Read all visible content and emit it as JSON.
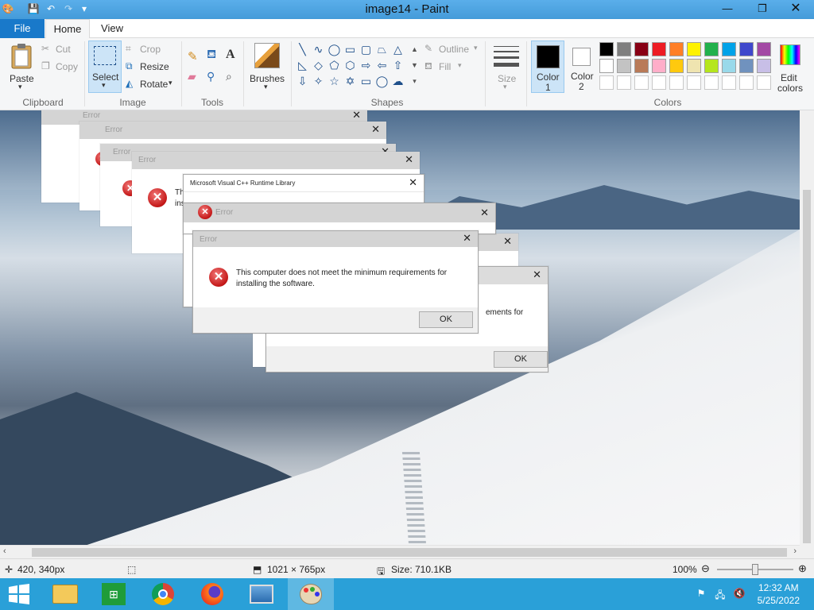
{
  "window": {
    "title": "image14 - Paint"
  },
  "menu": {
    "file": "File",
    "home": "Home",
    "view": "View"
  },
  "ribbon": {
    "clipboard": {
      "label": "Clipboard",
      "paste": "Paste",
      "cut": "Cut",
      "copy": "Copy"
    },
    "image": {
      "label": "Image",
      "select": "Select",
      "crop": "Crop",
      "resize": "Resize",
      "rotate": "Rotate"
    },
    "tools": {
      "label": "Tools"
    },
    "brushes": {
      "label": "Brushes"
    },
    "shapes": {
      "label": "Shapes",
      "outline": "Outline",
      "fill": "Fill"
    },
    "size": {
      "label": "Size"
    },
    "color1": {
      "label": "Color",
      "num": "1"
    },
    "color2": {
      "label": "Color",
      "num": "2"
    },
    "colors": {
      "label": "Colors"
    },
    "edit_colors": {
      "line1": "Edit",
      "line2": "colors"
    },
    "palette_row1": [
      "#000000",
      "#7f7f7f",
      "#880015",
      "#ed1c24",
      "#ff7f27",
      "#fff200",
      "#22b14c",
      "#00a2e8",
      "#3f48cc",
      "#a349a4"
    ],
    "palette_row2": [
      "#ffffff",
      "#c3c3c3",
      "#b97a57",
      "#ffaec9",
      "#ffc90e",
      "#efe4b0",
      "#b5e61d",
      "#99d9ea",
      "#7092be",
      "#c8bfe7"
    ]
  },
  "dialogs": {
    "ghost_error": "Error",
    "runtime_title": "Microsoft Visual C++ Runtime Library",
    "main_title": "Error",
    "message_line1": "This computer does not meet the minimum requirements for",
    "message_line2": "installing the software.",
    "ok": "OK",
    "partial_text": "ements for",
    "partial_th": "Th",
    "partial_ins": "ins"
  },
  "status": {
    "cursor": "420, 340px",
    "dimensions": "1021 × 765px",
    "size": "Size: 710.1KB",
    "zoom": "100%"
  },
  "taskbar": {
    "time": "12:32 AM",
    "date": "5/25/2022"
  }
}
